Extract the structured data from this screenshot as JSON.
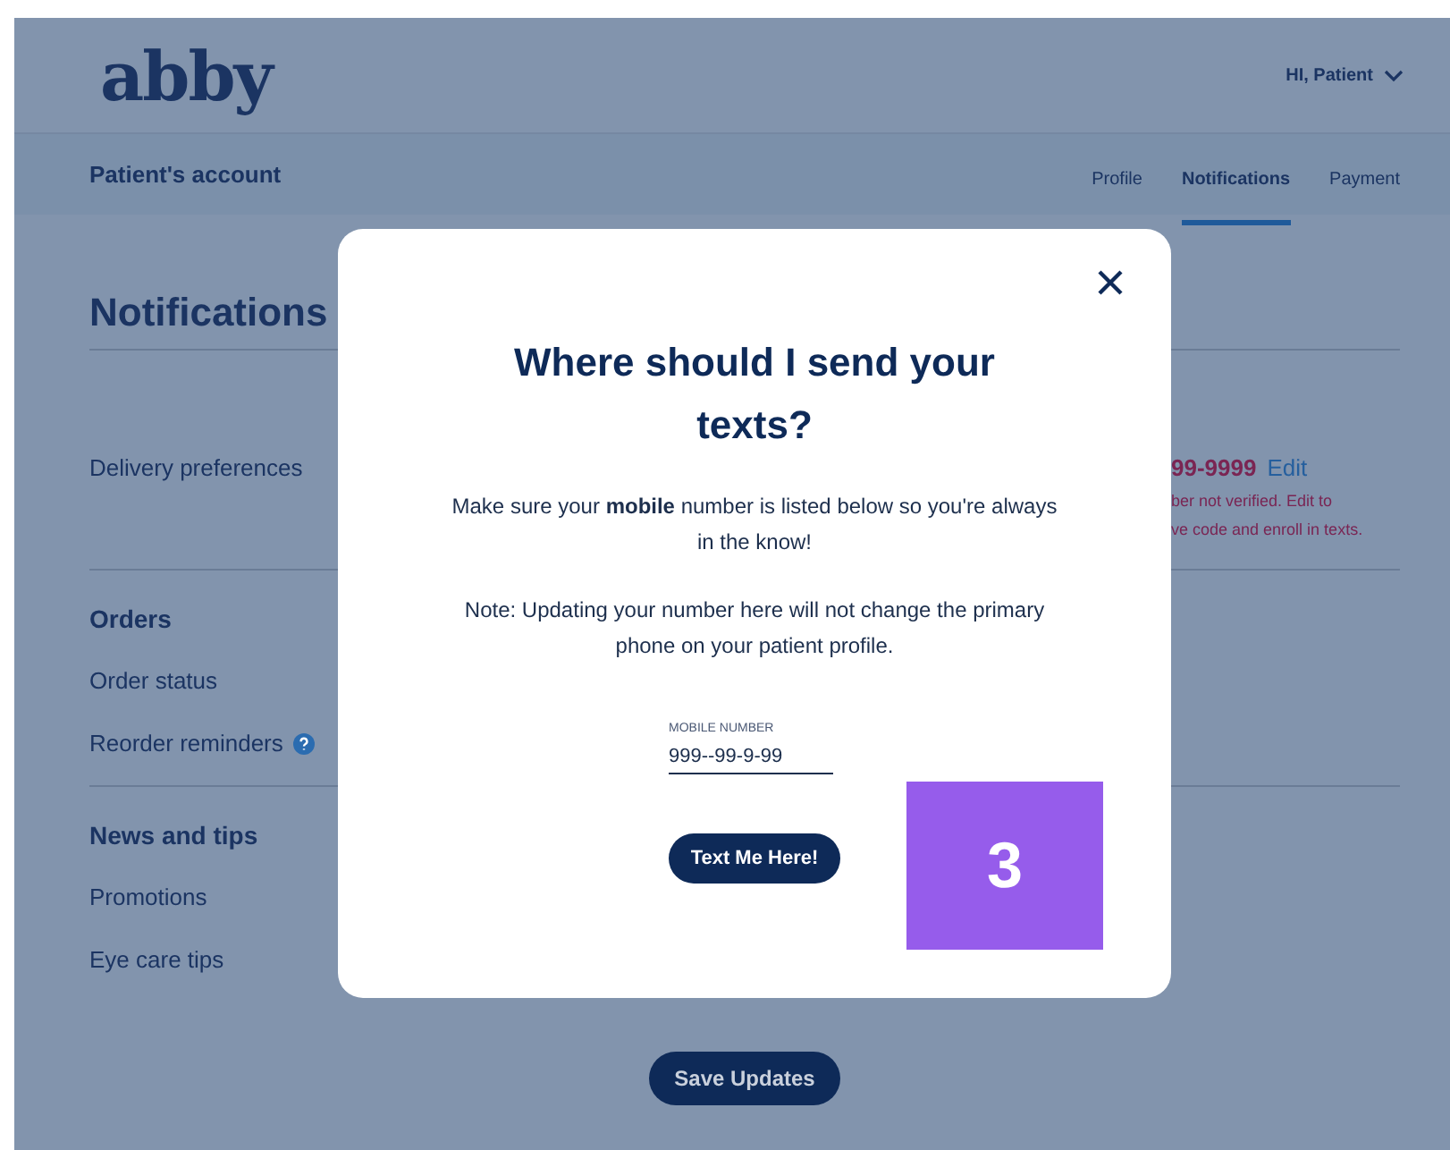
{
  "header": {
    "logo": "abby",
    "greeting": "HI, Patient"
  },
  "subnav": {
    "title": "Patient's account",
    "tabs": [
      {
        "label": "Profile",
        "selected": false
      },
      {
        "label": "Notifications",
        "selected": true
      },
      {
        "label": "Payment",
        "selected": false
      }
    ]
  },
  "page": {
    "heading": "Notifications",
    "delivery": {
      "label": "Delivery preferences",
      "phone": "99-9999",
      "edit_link": "Edit",
      "warning_lines": [
        "ber not verified. Edit to",
        "ve code and enroll in texts."
      ]
    },
    "sections": [
      {
        "title": "Orders",
        "items": [
          {
            "label": "Order status",
            "help_icon": false
          },
          {
            "label": "Reorder reminders",
            "help_icon": true
          }
        ]
      },
      {
        "title": "News and tips",
        "items": [
          {
            "label": "Promotions",
            "help_icon": false
          },
          {
            "label": "Eye care tips",
            "help_icon": false
          }
        ]
      }
    ],
    "save_button": "Save Updates"
  },
  "modal": {
    "title": "Where should I send your texts?",
    "message": "Make sure your **mobile** number is listed below so you're always in the know!",
    "note": "Note: Updating your number here will not change the primary phone on your patient profile.",
    "field": {
      "label": "MOBILE NUMBER",
      "value": "999--99-9-99"
    },
    "button": "Text Me Here!"
  },
  "step_badge": "3"
}
